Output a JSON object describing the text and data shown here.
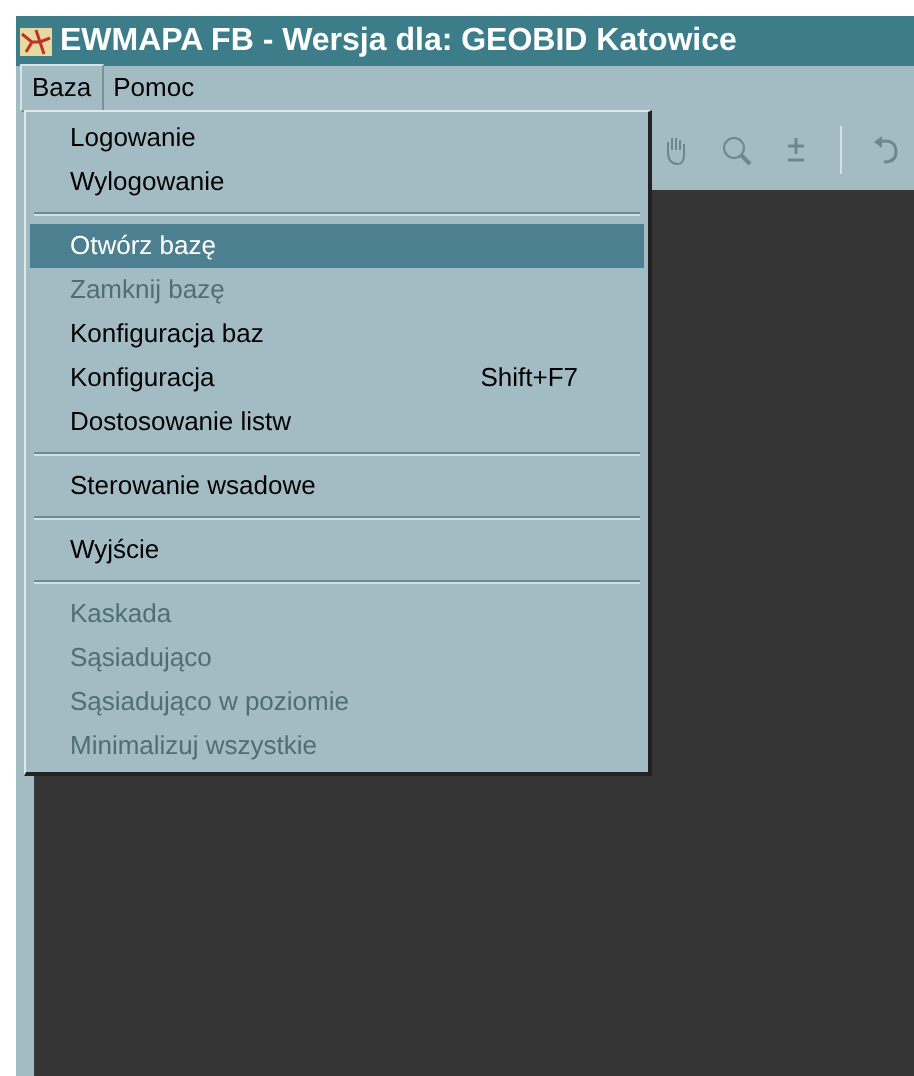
{
  "window": {
    "title": "EWMAPA FB - Wersja dla: GEOBID Katowice"
  },
  "menubar": [
    {
      "label": "Baza",
      "selected": true
    },
    {
      "label": "Pomoc",
      "selected": false
    }
  ],
  "menu": [
    {
      "kind": "item",
      "label": "Logowanie",
      "selected": false,
      "disabled": false
    },
    {
      "kind": "item",
      "label": "Wylogowanie",
      "selected": false,
      "disabled": false
    },
    {
      "kind": "separator"
    },
    {
      "kind": "item",
      "label": "Otwórz bazę",
      "selected": true,
      "disabled": false
    },
    {
      "kind": "item",
      "label": "Zamknij bazę",
      "selected": false,
      "disabled": true
    },
    {
      "kind": "item",
      "label": "Konfiguracja baz",
      "selected": false,
      "disabled": false
    },
    {
      "kind": "item",
      "label": "Konfiguracja",
      "shortcut": "Shift+F7",
      "selected": false,
      "disabled": false
    },
    {
      "kind": "item",
      "label": "Dostosowanie listw",
      "selected": false,
      "disabled": false
    },
    {
      "kind": "separator"
    },
    {
      "kind": "item",
      "label": "Sterowanie wsadowe",
      "selected": false,
      "disabled": false
    },
    {
      "kind": "separator"
    },
    {
      "kind": "item",
      "label": "Wyjście",
      "selected": false,
      "disabled": false
    },
    {
      "kind": "separator"
    },
    {
      "kind": "item",
      "label": "Kaskada",
      "selected": false,
      "disabled": true
    },
    {
      "kind": "item",
      "label": "Sąsiadująco",
      "selected": false,
      "disabled": true
    },
    {
      "kind": "item",
      "label": "Sąsiadująco w poziomie",
      "selected": false,
      "disabled": true
    },
    {
      "kind": "item",
      "label": "Minimalizuj wszystkie",
      "selected": false,
      "disabled": true
    }
  ]
}
